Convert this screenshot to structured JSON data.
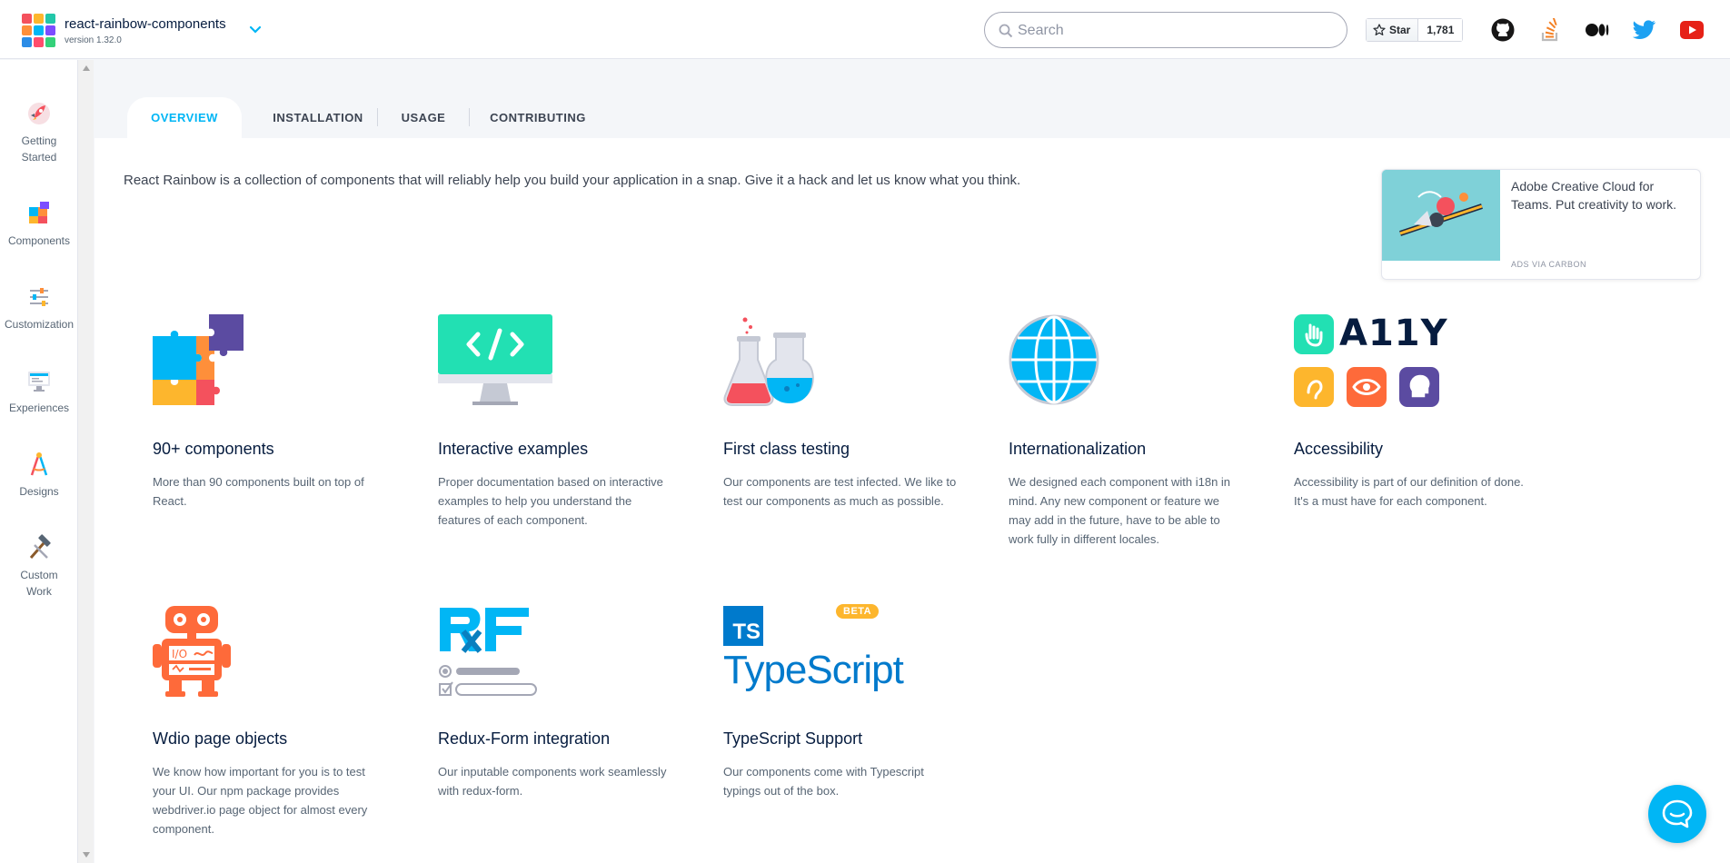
{
  "header": {
    "app_title": "react-rainbow-components",
    "app_version": "version 1.32.0",
    "search_placeholder": "Search",
    "star_label": "Star",
    "star_count": "1,781",
    "social_icons": [
      "github-icon",
      "stackoverflow-icon",
      "medium-icon",
      "twitter-icon",
      "youtube-icon"
    ]
  },
  "sidebar": {
    "items": [
      {
        "label": "Getting Started",
        "icon": "rocket-icon"
      },
      {
        "label": "Components",
        "icon": "puzzle-icon"
      },
      {
        "label": "Customization",
        "icon": "sliders-icon"
      },
      {
        "label": "Experiences",
        "icon": "monitor-icon"
      },
      {
        "label": "Designs",
        "icon": "compass-icon"
      },
      {
        "label": "Custom Work",
        "icon": "hammer-icon"
      }
    ]
  },
  "tabs": [
    {
      "label": "OVERVIEW",
      "active": true
    },
    {
      "label": "INSTALLATION",
      "active": false
    },
    {
      "label": "USAGE",
      "active": false
    },
    {
      "label": "CONTRIBUTING",
      "active": false
    }
  ],
  "intro": "React Rainbow is a collection of components that will reliably help you build your application in a snap. Give it a hack and let us know what you think.",
  "ad": {
    "text": "Adobe Creative Cloud for Teams. Put creativity to work.",
    "via": "ADS VIA CARBON"
  },
  "features": [
    {
      "title": "90+ components",
      "desc": "More than 90 components built on top of React.",
      "icon": "puzzle-pieces-icon"
    },
    {
      "title": "Interactive examples",
      "desc": "Proper documentation based on interactive examples to help you understand the features of each component.",
      "icon": "code-monitor-icon"
    },
    {
      "title": "First class testing",
      "desc": "Our components are test infected. We like to test our components as much as possible.",
      "icon": "flasks-icon"
    },
    {
      "title": "Internationalization",
      "desc": "We designed each component with i18n in mind. Any new component or feature we may add in the future, have to be able to work fully in different locales.",
      "icon": "globe-icon"
    },
    {
      "title": "Accessibility",
      "desc": "Accessibility is part of our definition of done. It's a must have for each component.",
      "icon": "a11y-icon",
      "badge_text": "A11Y"
    },
    {
      "title": "Wdio page objects",
      "desc": "We know how important for you is to test your UI. Our npm package provides webdriver.io page object for almost every component.",
      "icon": "robot-icon"
    },
    {
      "title": "Redux-Form integration",
      "desc": "Our inputable components work seamlessly with redux-form.",
      "icon": "redux-form-icon"
    },
    {
      "title": "TypeScript Support",
      "desc": "Our components come with Typescript typings out of the box.",
      "icon": "typescript-icon",
      "badge": "BETA",
      "logo_text": "TypeScript",
      "logo_abbr": "TS"
    }
  ],
  "colors": {
    "accent": "#01b6f5",
    "brand_dark": "#061c3f"
  }
}
